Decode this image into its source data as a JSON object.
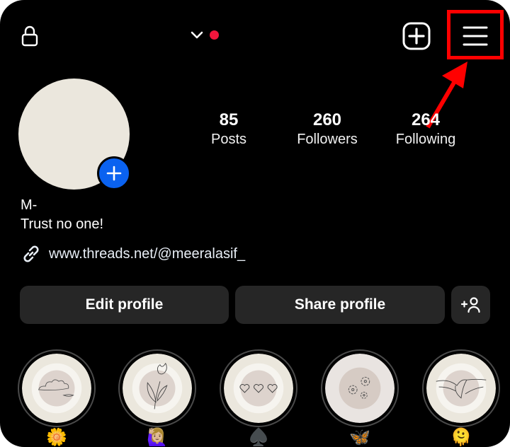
{
  "colors": {
    "background": "#000000",
    "accent_blue": "#0a62f0",
    "notification_red": "#f0163c",
    "annotation_red": "#ff0000",
    "button_bg": "#262626",
    "avatar_fill": "#ebe7dd"
  },
  "topbar": {
    "lock_icon": "lock-icon",
    "account_switcher_icon": "chevron-down-icon",
    "notification_dot": true,
    "new_post_icon": "plus-square-icon",
    "menu_icon": "hamburger-menu-icon"
  },
  "annotation": {
    "type": "highlight-box-with-arrow",
    "target": "menu-button"
  },
  "profile": {
    "avatar_add_icon": "plus-icon",
    "name": "M-",
    "bio": "Trust no one!",
    "link": "www.threads.net/@meeralasif_",
    "link_icon": "link-icon"
  },
  "stats": [
    {
      "value": "85",
      "label": "Posts"
    },
    {
      "value": "260",
      "label": "Followers"
    },
    {
      "value": "264",
      "label": "Following"
    }
  ],
  "actions": {
    "edit_profile": "Edit profile",
    "share_profile": "Share profile",
    "discover_people_icon": "add-person-icon"
  },
  "highlights": [
    {
      "cover": "cloud-sketch",
      "label": "🌼",
      "ring": "#ebe7dd"
    },
    {
      "cover": "tulip-sketch",
      "label": "🙋🏼‍♀️",
      "ring": "#ebe7dd"
    },
    {
      "cover": "three-hearts-sketch",
      "label": "♠️",
      "ring": "#ebe7dd"
    },
    {
      "cover": "flowers-sketch",
      "label": "🦋",
      "ring": "#e9e4e1"
    },
    {
      "cover": "heart-hands-sketch",
      "label": "🫠",
      "ring": "#ebe7dd"
    }
  ]
}
